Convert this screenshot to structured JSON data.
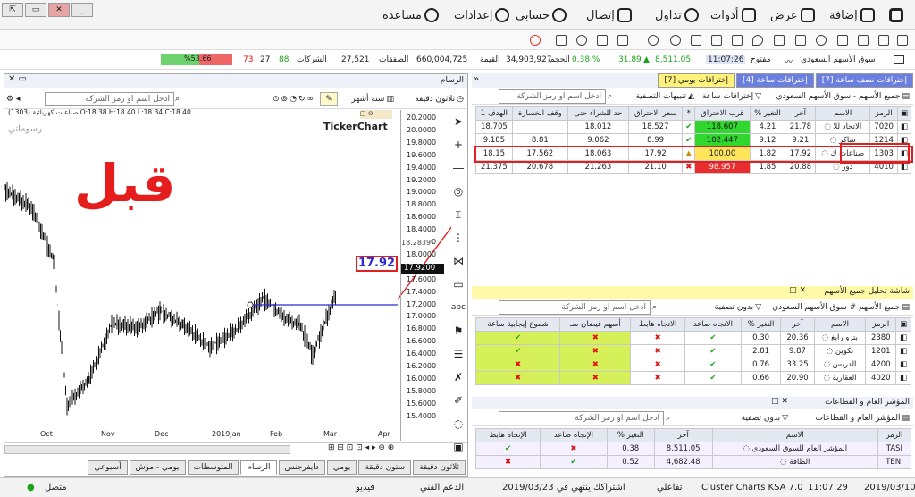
{
  "menu": {
    "help": "مساعدة",
    "settings": "إعدادات",
    "account": "حسابي",
    "contact": "إتصال",
    "trade": "تداول",
    "tools": "أدوات",
    "view": "عرض",
    "add": "إضافة"
  },
  "window": {
    "controls": [
      "⇱",
      "▭",
      "✕",
      "_"
    ]
  },
  "ticker": {
    "market": "سوق الأسهم السعودي",
    "open_label": "مفتوح",
    "time": "11:07:26",
    "index": "8,511.05",
    "change": "31.89",
    "change_pct": "0.38 %",
    "volume_label": "الحجم",
    "volume": "34,903,927",
    "value_label": "القيمة",
    "value": "660,004,725",
    "deals_label": "الصفقات",
    "deals": "27,521",
    "companies_label": "الشركات",
    "up": "88",
    "unch": "27",
    "down": "73",
    "bar_pct": "%53.66"
  },
  "chart": {
    "title": "الرسام",
    "interval": "ثلاثون دقيقة",
    "period": "ستة أشهر",
    "search_placeholder": "ادخل اسم او رمز الشركة",
    "ohlc": "(1303) صناعات كهربائية O:18.38 H:18.40 L:18.34 C:18.40",
    "brand": "TickerChart",
    "drawings": "رسوماتي",
    "watermark": "قبل",
    "price_box": "17.92",
    "price_label": "17.9200",
    "top_label": "18.2839",
    "y_ticks": [
      "20.2000",
      "20.0000",
      "19.8000",
      "19.6000",
      "19.4000",
      "19.2000",
      "19.0000",
      "18.8000",
      "18.6000",
      "18.4000",
      "18.2000",
      "18.0000",
      "17.8000",
      "17.6000",
      "17.4000",
      "17.2000",
      "17.0000",
      "16.8000",
      "16.6000",
      "16.4000",
      "16.2000",
      "16.0000",
      "15.8000",
      "15.6000",
      "15.4000"
    ],
    "x_ticks": [
      "Oct",
      "Nov",
      "Dec",
      "2019Jan",
      "Feb",
      "Mar",
      "Apr"
    ],
    "bottom_tabs": [
      "ثلاثون دقيقة",
      "ستون دقيقة",
      "يومي",
      "دايفرجنس",
      "الرسام",
      "المتوسطات",
      "يومي - مؤش",
      "أسبوعي"
    ]
  },
  "alerts": {
    "tabs": [
      "إختراقات نصف ساعة [7]",
      "إختراقات ساعة [4]",
      "إختراقات يومي [7]"
    ],
    "market_filter": "جميع الأسهم - سوق الأسهم السعودي",
    "tab_filter": "إختراقات ساعة",
    "notify": "تنبيهات التصفية",
    "search_placeholder": "ادخل اسم او رمز الشركة",
    "headers": [
      "الرمز",
      "الاسم",
      "آخر",
      "التغير %",
      "قرب الاختراق",
      "*",
      "سعر الاختراق",
      "حد للشراء حتى",
      "وقف الخسارة",
      "الهدف 1"
    ],
    "rows": [
      {
        "code": "7020",
        "name": "الاتحاد للا",
        "last": "21.78",
        "chg": "4.21",
        "near": "118.607",
        "status": "check",
        "break": "18.527",
        "buy": "18.012",
        "stop": "",
        "target": "18.705"
      },
      {
        "code": "1214",
        "name": "شاكر",
        "last": "9.21",
        "chg": "9.12",
        "near": "102.447",
        "status": "check",
        "break": "8.99",
        "buy": "9.062",
        "stop": "8.81",
        "target": "9.185"
      },
      {
        "code": "1303",
        "name": "صناعات ك",
        "last": "17.92",
        "chg": "1.82",
        "near": "100.00",
        "status": "warn",
        "break": "17.92",
        "buy": "18.063",
        "stop": "17.562",
        "target": "18.15"
      },
      {
        "code": "4010",
        "name": "دور",
        "last": "20.88",
        "chg": "1.85",
        "near": "98.957",
        "status": "cross",
        "break": "21.10",
        "buy": "21.263",
        "stop": "20.678",
        "target": "21.375"
      }
    ]
  },
  "analysis": {
    "title": "شاشة تحليل جميع الأسهم",
    "market_filter": "جميع الأسهم # سوق الأسهم السعودي",
    "no_filter": "بدون تصفية",
    "search_placeholder": "ادخل اسم او رمز الشركة",
    "headers": [
      "الرمز",
      "الاسم",
      "آخر",
      "التغير %",
      "الاتجاه صاعد",
      "الاتجاه هابط",
      "أسهم فيضان سـ",
      "شموع إيجابية ساعة"
    ],
    "rows": [
      {
        "code": "2380",
        "name": "بترو رابغ",
        "last": "20.36",
        "chg": "0.30",
        "up": "check",
        "down": "cross",
        "f": "cross",
        "c": "check"
      },
      {
        "code": "1201",
        "name": "تكوين",
        "last": "9.87",
        "chg": "2.81",
        "up": "check",
        "down": "cross",
        "f": "cross",
        "c": "check"
      },
      {
        "code": "4200",
        "name": "الدريس",
        "last": "33.25",
        "chg": "0.76",
        "up": "check",
        "down": "cross",
        "f": "cross",
        "c": "cross"
      },
      {
        "code": "4020",
        "name": "العقارية",
        "last": "20.90",
        "chg": "0.66",
        "up": "check",
        "down": "cross",
        "f": "cross",
        "c": "cross"
      }
    ]
  },
  "sectors": {
    "title": "المؤشر العام و القطاعات",
    "filter": "المؤشر العام و القطاعات",
    "no_filter": "بدون تصفية",
    "search_placeholder": "ادخل اسم او رمز الشركة",
    "headers": [
      "الرمز",
      "الاسم",
      "آخر",
      "التغير %",
      "الإتجاه صاعد",
      "الإتجاه هابط"
    ],
    "rows": [
      {
        "code": "TASI",
        "name": "المؤشر العام للسوق السعودي",
        "last": "8,511.05",
        "chg": "0.38",
        "up": "cross",
        "down": "check"
      },
      {
        "code": "TENI",
        "name": "الطاقة",
        "last": "4,682.48",
        "chg": "0.52",
        "up": "check",
        "down": "cross"
      }
    ]
  },
  "status": {
    "date": "2019/03/10",
    "time": "11:07:29",
    "product": "Cluster Charts KSA 7.0",
    "notifications": "تفاعلي",
    "subscription": "اشتراكك ينتهي في 2019/03/23",
    "support": "الدعم الفني",
    "video": "فيديو",
    "connected": "متصل"
  },
  "colors": {
    "up": "#19a319",
    "down": "#d11111",
    "highlight": "#e02020",
    "accent": "#2a2ad0"
  }
}
